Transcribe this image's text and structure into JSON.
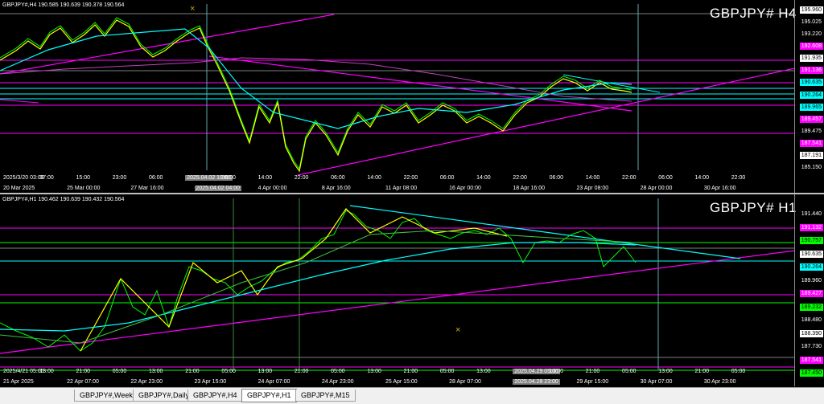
{
  "colors": {
    "bg": "#000000",
    "magenta": "#ff00ff",
    "cyan": "#00ffff",
    "yellow": "#ffff00",
    "green": "#00ff00",
    "white": "#ffffff"
  },
  "top": {
    "header": "GBPJPY#,H4  190.585 190.639 190.378 190.564",
    "title": "GBPJPY# H4",
    "price_labels": [
      {
        "v": "195.960",
        "style": "box"
      },
      {
        "v": "195.025",
        "style": ""
      },
      {
        "v": "193.220",
        "style": ""
      },
      {
        "v": "192.608",
        "style": "mag"
      },
      {
        "v": "191.935",
        "style": "box"
      },
      {
        "v": "191.136",
        "style": "mag"
      },
      {
        "v": "190.635",
        "style": "cyan"
      },
      {
        "v": "190.264",
        "style": "cyan"
      },
      {
        "v": "189.965",
        "style": "cyan"
      },
      {
        "v": "189.457",
        "style": "mag"
      },
      {
        "v": "189.475",
        "style": ""
      },
      {
        "v": "187.541",
        "style": "mag"
      },
      {
        "v": "187.191",
        "style": "box"
      },
      {
        "v": "185.150",
        "style": ""
      }
    ],
    "time_labels": [
      "2025/3/20 03:00",
      "07:00",
      "15:00",
      "23:00",
      "06:00",
      "2025.04.02 10:00",
      "06:00",
      "14:00",
      "22:00",
      "06:00",
      "14:00",
      "22:00",
      "06:00",
      "14:00",
      "22:00",
      "06:00",
      "14:00",
      "22:00",
      "06:00",
      "14:00",
      "22:00"
    ],
    "date_labels": [
      "20 Mar 2025",
      "25 Mar 00:00",
      "27 Mar 16:00",
      "2025.04.02 04:00",
      "4 Apr 00:00",
      "8 Apr 16:00",
      "11 Apr 08:00",
      "16 Apr 00:00",
      "18 Apr 16:00",
      "23 Apr 08:00",
      "28 Apr 00:00",
      "30 Apr 16:00"
    ]
  },
  "bottom": {
    "header": "GBPJPY#,H1  190.462 190.639 190.432 190.564",
    "title": "GBPJPY# H1",
    "price_labels": [
      {
        "v": "191.440",
        "style": ""
      },
      {
        "v": "191.132",
        "style": "mag"
      },
      {
        "v": "190.757",
        "style": "green"
      },
      {
        "v": "190.635",
        "style": "box"
      },
      {
        "v": "190.264",
        "style": "cyan"
      },
      {
        "v": "189.960",
        "style": ""
      },
      {
        "v": "189.427",
        "style": "mag"
      },
      {
        "v": "189.232",
        "style": "green"
      },
      {
        "v": "188.480",
        "style": ""
      },
      {
        "v": "188.390",
        "style": "box"
      },
      {
        "v": "187.730",
        "style": ""
      },
      {
        "v": "187.541",
        "style": "mag"
      },
      {
        "v": "187.450",
        "style": "green"
      }
    ],
    "time_labels": [
      "2025/4/21 05:00",
      "13:00",
      "21:00",
      "05:00",
      "13:00",
      "21:00",
      "05:00",
      "13:00",
      "21:00",
      "05:00",
      "13:00",
      "21:00",
      "05:00",
      "13:00",
      "2025.04.29 05:00",
      "13:00",
      "21:00",
      "05:00",
      "13:00",
      "21:00",
      "05:00"
    ],
    "date_labels": [
      "21 Apr 2025",
      "22 Apr 07:00",
      "22 Apr 23:00",
      "23 Apr 15:00",
      "24 Apr 07:00",
      "24 Apr 23:00",
      "25 Apr 15:00",
      "28 Apr 07:00",
      "2025.04.28 23:00",
      "29 Apr 15:00",
      "30 Apr 07:00",
      "30 Apr 23:00"
    ]
  },
  "tabs": [
    "GBPJPY#,Weekly",
    "GBPJPY#,Daily",
    "GBPJPY#,H4",
    "GBPJPY#,H1",
    "GBPJPY#,M15"
  ],
  "active_tab": "GBPJPY#,H1"
}
